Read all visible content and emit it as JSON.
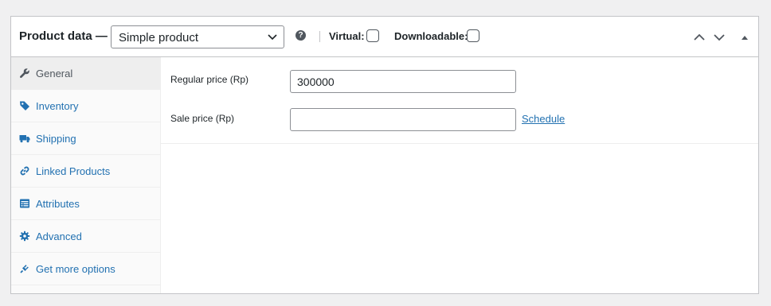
{
  "header": {
    "title": "Product data —",
    "product_type": "Simple product",
    "help": "?",
    "virtual_label": "Virtual:",
    "virtual_checked": false,
    "downloadable_label": "Downloadable:",
    "downloadable_checked": false
  },
  "tabs": [
    {
      "label": "General",
      "icon": "wrench-icon",
      "active": true
    },
    {
      "label": "Inventory",
      "icon": "tag-icon",
      "active": false
    },
    {
      "label": "Shipping",
      "icon": "truck-icon",
      "active": false
    },
    {
      "label": "Linked Products",
      "icon": "link-icon",
      "active": false
    },
    {
      "label": "Attributes",
      "icon": "list-icon",
      "active": false
    },
    {
      "label": "Advanced",
      "icon": "gear-icon",
      "active": false
    },
    {
      "label": "Get more options",
      "icon": "plugin-icon",
      "active": false
    }
  ],
  "general": {
    "regular_price_label": "Regular price (Rp)",
    "regular_price_value": "300000",
    "sale_price_label": "Sale price (Rp)",
    "sale_price_value": "",
    "schedule_link": "Schedule"
  },
  "colors": {
    "link": "#2271b1",
    "icon": "#2271b1",
    "border": "#c3c4c7"
  }
}
